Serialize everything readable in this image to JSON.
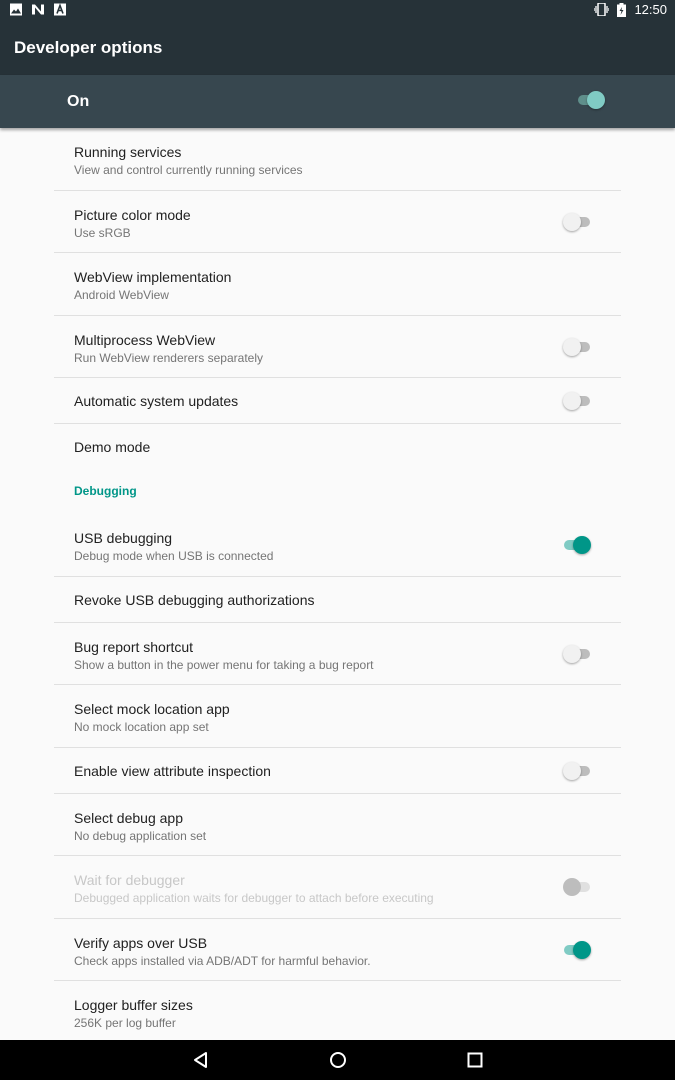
{
  "status": {
    "time": "12:50",
    "left_icons": [
      "image-icon",
      "n-icon",
      "a-icon"
    ],
    "right_icons": [
      "vibrate-icon",
      "battery-icon"
    ]
  },
  "appbar": {
    "title": "Developer options"
  },
  "master": {
    "label": "On",
    "checked": true
  },
  "items": [
    {
      "title": "Running services",
      "summary": "View and control currently running services"
    },
    {
      "title": "Picture color mode",
      "summary": "Use sRGB",
      "switch": false
    },
    {
      "title": "WebView implementation",
      "summary": "Android WebView"
    },
    {
      "title": "Multiprocess WebView",
      "summary": "Run WebView renderers separately",
      "switch": false
    },
    {
      "title": "Automatic system updates",
      "switch": false
    },
    {
      "title": "Demo mode"
    }
  ],
  "category": {
    "title": "Debugging"
  },
  "debug_items": [
    {
      "title": "USB debugging",
      "summary": "Debug mode when USB is connected",
      "switch": true
    },
    {
      "title": "Revoke USB debugging authorizations"
    },
    {
      "title": "Bug report shortcut",
      "summary": "Show a button in the power menu for taking a bug report",
      "switch": false
    },
    {
      "title": "Select mock location app",
      "summary": "No mock location app set"
    },
    {
      "title": "Enable view attribute inspection",
      "switch": false
    },
    {
      "title": "Select debug app",
      "summary": "No debug application set"
    },
    {
      "title": "Wait for debugger",
      "summary": "Debugged application waits for debugger to attach before executing",
      "switch": false,
      "disabled": true
    },
    {
      "title": "Verify apps over USB",
      "summary": "Check apps installed via ADB/ADT for harmful behavior.",
      "switch": true
    },
    {
      "title": "Logger buffer sizes",
      "summary": "256K per log buffer"
    }
  ],
  "nav": {
    "icons": [
      "back-icon",
      "home-icon",
      "recents-icon"
    ]
  },
  "colors": {
    "accent": "#009688",
    "appbar": "#263238",
    "master_bar": "#37474f"
  }
}
